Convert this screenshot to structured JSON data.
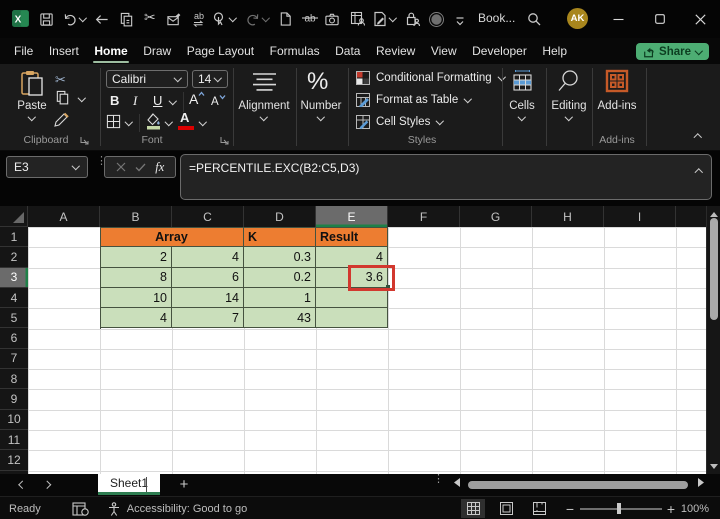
{
  "window": {
    "title": "Book...",
    "avatar_initials": "AK",
    "logo_letter": "X"
  },
  "quick_access_icons": [
    "excel-logo",
    "save",
    "undo",
    "back-arrow",
    "copy",
    "cut",
    "email-edit",
    "find-replace",
    "touch-mode",
    "redo",
    "new-file",
    "strikethrough",
    "camera",
    "share-workbook",
    "edit-document",
    "permissions-lock",
    "record",
    "qat-overflow",
    "search",
    "minimize",
    "maximize",
    "close"
  ],
  "menu": {
    "items": [
      "File",
      "Insert",
      "Home",
      "Draw",
      "Page Layout",
      "Formulas",
      "Data",
      "Review",
      "View",
      "Developer",
      "Help"
    ],
    "active": "Home",
    "share_label": "Share"
  },
  "ribbon": {
    "paste_label": "Paste",
    "clipboard_group": "Clipboard",
    "font_name": "Calibri",
    "font_size": "14",
    "font_group": "Font",
    "bold_glyph": "B",
    "italic_glyph": "I",
    "underline_glyph": "U",
    "grow_font_glyph": "A",
    "shrink_font_glyph": "A",
    "font_color_glyph": "A",
    "cut_glyph": "✂",
    "percent_glyph": "%",
    "alignment_label": "Alignment",
    "number_label": "Number",
    "conditional_formatting_label": "Conditional Formatting",
    "format_as_table_label": "Format as Table",
    "cell_styles_label": "Cell Styles",
    "styles_group": "Styles",
    "cells_label": "Cells",
    "editing_label": "Editing",
    "addins_label": "Add-ins",
    "addins_group": "Add-ins"
  },
  "formula_bar": {
    "cell_reference": "E3",
    "fx_label": "fx",
    "formula": "=PERCENTILE.EXC(B2:C5,D3)"
  },
  "sheet": {
    "column_headers": [
      "A",
      "B",
      "C",
      "D",
      "E",
      "F",
      "G",
      "H",
      "I"
    ],
    "row_headers": [
      "1",
      "2",
      "3",
      "4",
      "5",
      "6",
      "7",
      "8",
      "9",
      "10",
      "11",
      "12"
    ],
    "selected_column": "E",
    "selected_row": "3",
    "active_cell": "E3",
    "table": {
      "header_cells": [
        {
          "label": "Array",
          "cols": [
            "B",
            "C"
          ],
          "align": "center"
        },
        {
          "label": "K",
          "cols": [
            "D"
          ],
          "align": "left"
        },
        {
          "label": "Result",
          "cols": [
            "E"
          ],
          "align": "left"
        }
      ],
      "data_rows": [
        {
          "row": 2,
          "cells": {
            "B": "2",
            "C": "4",
            "D": "0.3",
            "E": "4"
          }
        },
        {
          "row": 3,
          "cells": {
            "B": "8",
            "C": "6",
            "D": "0.2",
            "E": "3.6"
          }
        },
        {
          "row": 4,
          "cells": {
            "B": "10",
            "C": "14",
            "D": "1",
            "E": ""
          }
        },
        {
          "row": 5,
          "cells": {
            "B": "4",
            "C": "7",
            "D": "43",
            "E": ""
          }
        }
      ],
      "colors": {
        "header_fill": "#ED7D31",
        "data_fill": "#CADFBB",
        "border": "#45523F",
        "annotation_red": "#D2382E"
      }
    }
  },
  "sheet_tabs": {
    "sheets": [
      "Sheet1"
    ],
    "active": "Sheet1",
    "add_label": "+"
  },
  "status_bar": {
    "mode": "Ready",
    "accessibility": "Accessibility: Good to go",
    "zoom_level": "100%",
    "zoom_minus": "−",
    "zoom_plus": "+"
  },
  "theme": {
    "accent_green": "#1F8048",
    "share_button_green": "#4DAD73",
    "titlebar": "#050505",
    "ribbon_bg": "#1B1B1B"
  }
}
